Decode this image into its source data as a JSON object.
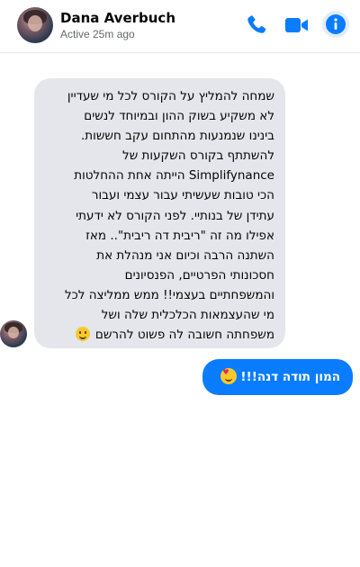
{
  "header": {
    "name": "Dana Averbuch",
    "status": "Active 25m ago",
    "icons": [
      "phone-icon",
      "video-camera-icon",
      "info-icon"
    ],
    "accent_color": "#0a7cff"
  },
  "messages": {
    "incoming": {
      "lines": [
        "שמחה להמליץ על הקורס לכל מי שעדיין",
        "לא משקיע בשוק ההון ובמיוחד לנשים",
        "בינינו שנמנעות מהתחום עקב חששות.",
        "להשתתף בקורס השקעות של",
        "Simplifynance הייתה אחת ההחלטות",
        "הכי טובות שעשיתי עבור עצמי ועבור",
        "עתידן של בנותיי. לפני הקורס לא ידעתי",
        "אפילו מה זה \"ריבית דה ריבית\".. מאז",
        "השתנה הרבה וכיום אני מנהלת את",
        "חסכונותי הפרטיים, הפנסיונים",
        "והמשפחתיים בעצמי!! ממש ממליצה לכל",
        "מי שהעצמאות הכלכלית שלה ושל",
        "משפחתה חשובה לה פשוט להרשם"
      ],
      "emoji": "smiling-face-emoji",
      "bubble_color": "#e4e6eb"
    },
    "outgoing": {
      "text": "המון תודה דנה!!!",
      "emoji": "smiling-face-with-hearts-emoji",
      "bubble_color": "#0a7cff"
    }
  }
}
